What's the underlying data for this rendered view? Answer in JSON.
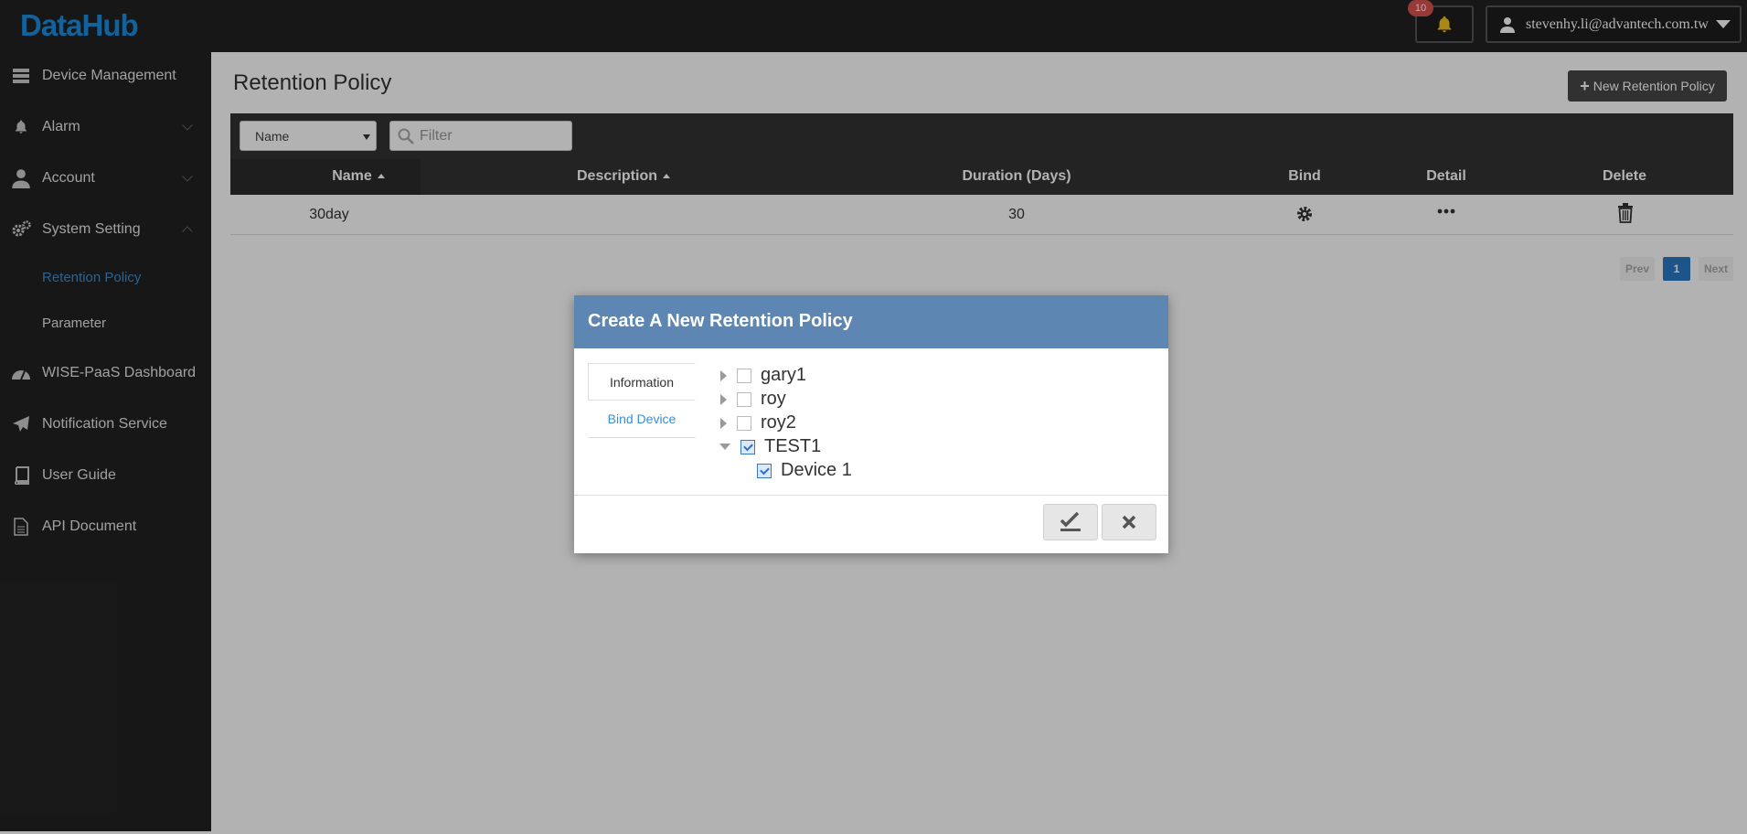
{
  "app": {
    "logo": "DataHub"
  },
  "header": {
    "notifications_count": "10",
    "user_email": "stevenhy.li@advantech.com.tw"
  },
  "sidebar": {
    "items": [
      {
        "label": "Device Management"
      },
      {
        "label": "Alarm"
      },
      {
        "label": "Account"
      },
      {
        "label": "System Setting"
      },
      {
        "label": "Retention Policy"
      },
      {
        "label": "Parameter"
      },
      {
        "label": "WISE-PaaS Dashboard"
      },
      {
        "label": "Notification Service"
      },
      {
        "label": "User Guide"
      },
      {
        "label": "API Document"
      }
    ]
  },
  "main": {
    "title": "Retention Policy",
    "new_button": "New Retention Policy",
    "filter_select": "Name",
    "filter_placeholder": "Filter",
    "columns": [
      "Name",
      "Description",
      "Duration (Days)",
      "Bind",
      "Detail",
      "Delete"
    ],
    "rows": [
      {
        "name": "30day",
        "description": "",
        "duration": "30"
      }
    ],
    "pagination": {
      "prev": "Prev",
      "current": "1",
      "next": "Next"
    }
  },
  "modal": {
    "title": "Create A New Retention Policy",
    "tabs": [
      "Information",
      "Bind Device"
    ],
    "tree": [
      {
        "label": "gary1",
        "checked": false,
        "expanded": false
      },
      {
        "label": "roy",
        "checked": false,
        "expanded": false
      },
      {
        "label": "roy2",
        "checked": false,
        "expanded": false
      },
      {
        "label": "TEST1",
        "checked": true,
        "expanded": true
      },
      {
        "label": "Device 1",
        "checked": true
      }
    ]
  },
  "colors": {
    "accent": "#1a8ee1",
    "modal_header": "#5d86b2",
    "active_link": "#3a8fd4",
    "topbar": "#222222"
  }
}
